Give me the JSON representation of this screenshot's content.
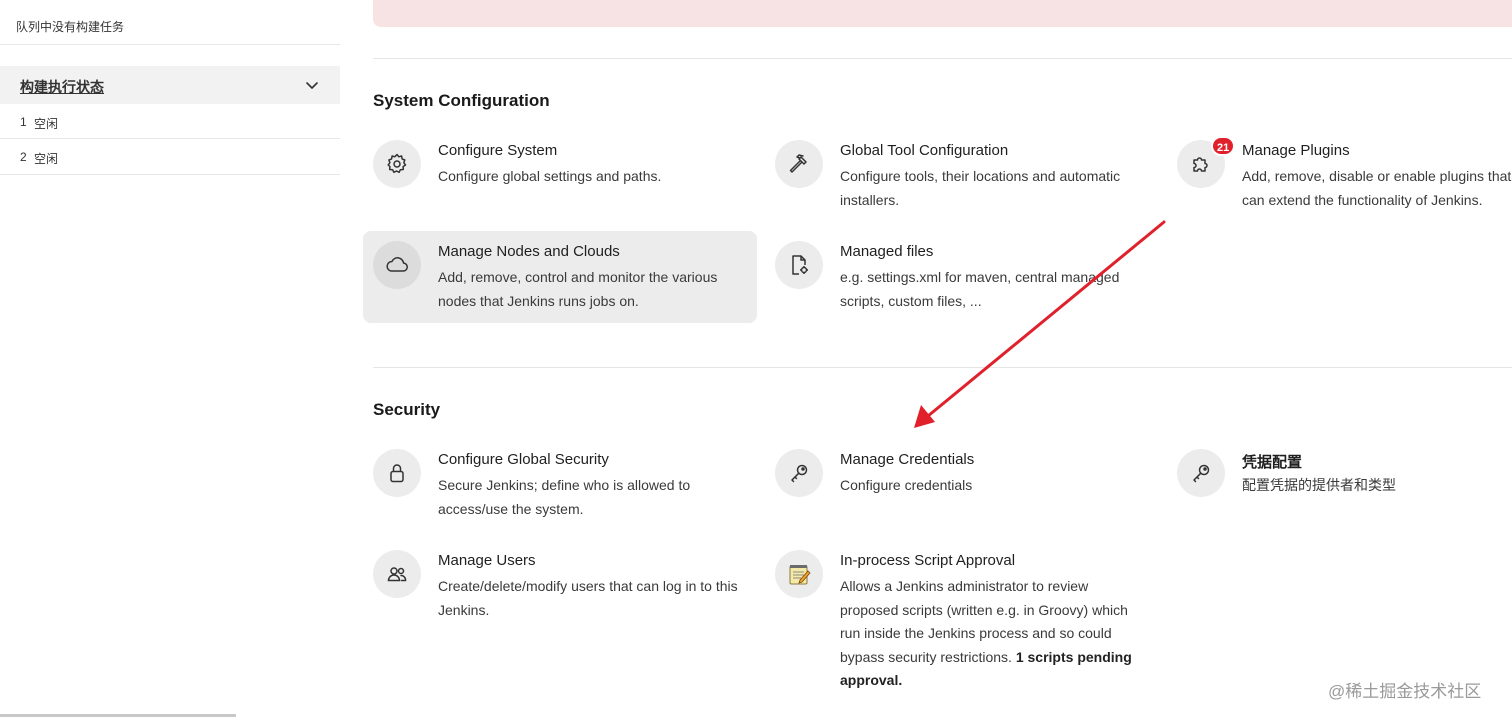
{
  "sidebar": {
    "queue_empty": "队列中没有构建任务",
    "executor_status_title": "构建执行状态",
    "executors": [
      {
        "num": "1",
        "status": "空闲"
      },
      {
        "num": "2",
        "status": "空闲"
      }
    ]
  },
  "sections": {
    "system": {
      "title": "System Configuration",
      "items": [
        {
          "title": "Configure System",
          "desc": "Configure global settings and paths.",
          "icon": "gear-icon"
        },
        {
          "title": "Global Tool Configuration",
          "desc": "Configure tools, their locations and automatic installers.",
          "icon": "hammer-icon"
        },
        {
          "title": "Manage Plugins",
          "desc": "Add, remove, disable or enable plugins that can extend the functionality of Jenkins.",
          "icon": "puzzle-icon",
          "badge": "21"
        },
        {
          "title": "Manage Nodes and Clouds",
          "desc": "Add, remove, control and monitor the various nodes that Jenkins runs jobs on.",
          "icon": "cloud-icon"
        },
        {
          "title": "Managed files",
          "desc": "e.g. settings.xml for maven, central managed scripts, custom files, ...",
          "icon": "file-gear-icon"
        }
      ]
    },
    "security": {
      "title": "Security",
      "items": [
        {
          "title": "Configure Global Security",
          "desc": "Secure Jenkins; define who is allowed to access/use the system.",
          "icon": "lock-icon"
        },
        {
          "title": "Manage Credentials",
          "desc": "Configure credentials",
          "icon": "key-icon"
        },
        {
          "title": "凭据配置",
          "desc": "配置凭据的提供者和类型",
          "icon": "key-icon"
        },
        {
          "title": "Manage Users",
          "desc": "Create/delete/modify users that can log in to this Jenkins.",
          "icon": "users-icon"
        },
        {
          "title": "In-process Script Approval",
          "desc": "Allows a Jenkins administrator to review proposed scripts (written e.g. in Groovy) which run inside the Jenkins process and so could bypass security restrictions.",
          "desc_bold": "1 scripts pending approval.",
          "icon": "notepad-icon"
        }
      ]
    }
  },
  "colors": {
    "badge": "#e0202b",
    "annotation_arrow": "#e0202b",
    "alert_band": "#f7e3e4"
  },
  "watermark": "@稀土掘金技术社区"
}
